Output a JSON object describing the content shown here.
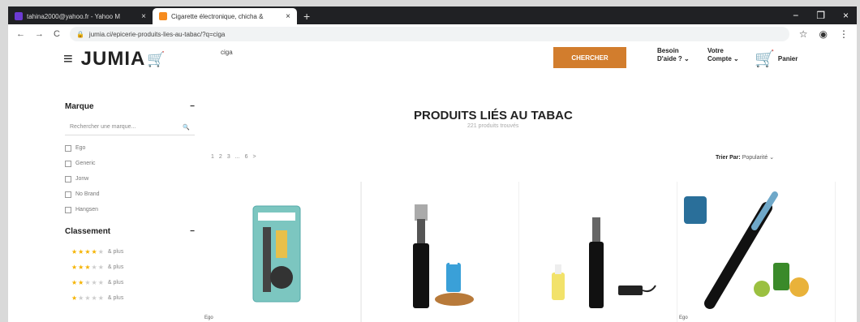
{
  "browser": {
    "tabs": [
      {
        "title": "tahina2000@yahoo.fr - Yahoo M",
        "close": "×"
      },
      {
        "title": "Cigarette électronique, chicha &",
        "close": "×"
      }
    ],
    "new_tab": "+",
    "window_controls": [
      "−",
      "❐",
      "×"
    ],
    "url": "jumia.ci/epicerie-produits-lies-au-tabac/?q=ciga",
    "nav_icons": [
      "←",
      "→",
      "C"
    ]
  },
  "header": {
    "logo": "JUMIA",
    "search_value": "ciga",
    "search_button": "CHERCHER",
    "help_line1": "Besoin",
    "help_line2": "D'aide ? ⌄",
    "account_line1": "Votre",
    "account_line2": "Compte ⌄",
    "cart_label": "Panier"
  },
  "sidebar": {
    "brand_heading": "Marque",
    "brand_search_placeholder": "Rechercher une marque...",
    "brands": [
      "Ego",
      "Generic",
      "Jonw",
      "No Brand",
      "Hangsen"
    ],
    "rating_heading": "Classement",
    "ratings": [
      {
        "stars": 4,
        "label": "& plus"
      },
      {
        "stars": 3,
        "label": "& plus"
      },
      {
        "stars": 2,
        "label": "& plus"
      },
      {
        "stars": 1,
        "label": "& plus"
      }
    ],
    "toggle": "−"
  },
  "main": {
    "title": "PRODUITS LIÉS AU TABAC",
    "count_text": "221 produits trouvés",
    "pages": [
      "1",
      "2",
      "3",
      "...",
      "6",
      ">"
    ],
    "sort_label": "Trier Par:",
    "sort_value": "Popularité",
    "products": [
      {
        "title": "Ego"
      },
      {
        "title": ""
      },
      {
        "title": ""
      },
      {
        "title": "Ego"
      }
    ]
  },
  "colors": {
    "accent": "#d27d2d",
    "star": "#f5b301"
  }
}
